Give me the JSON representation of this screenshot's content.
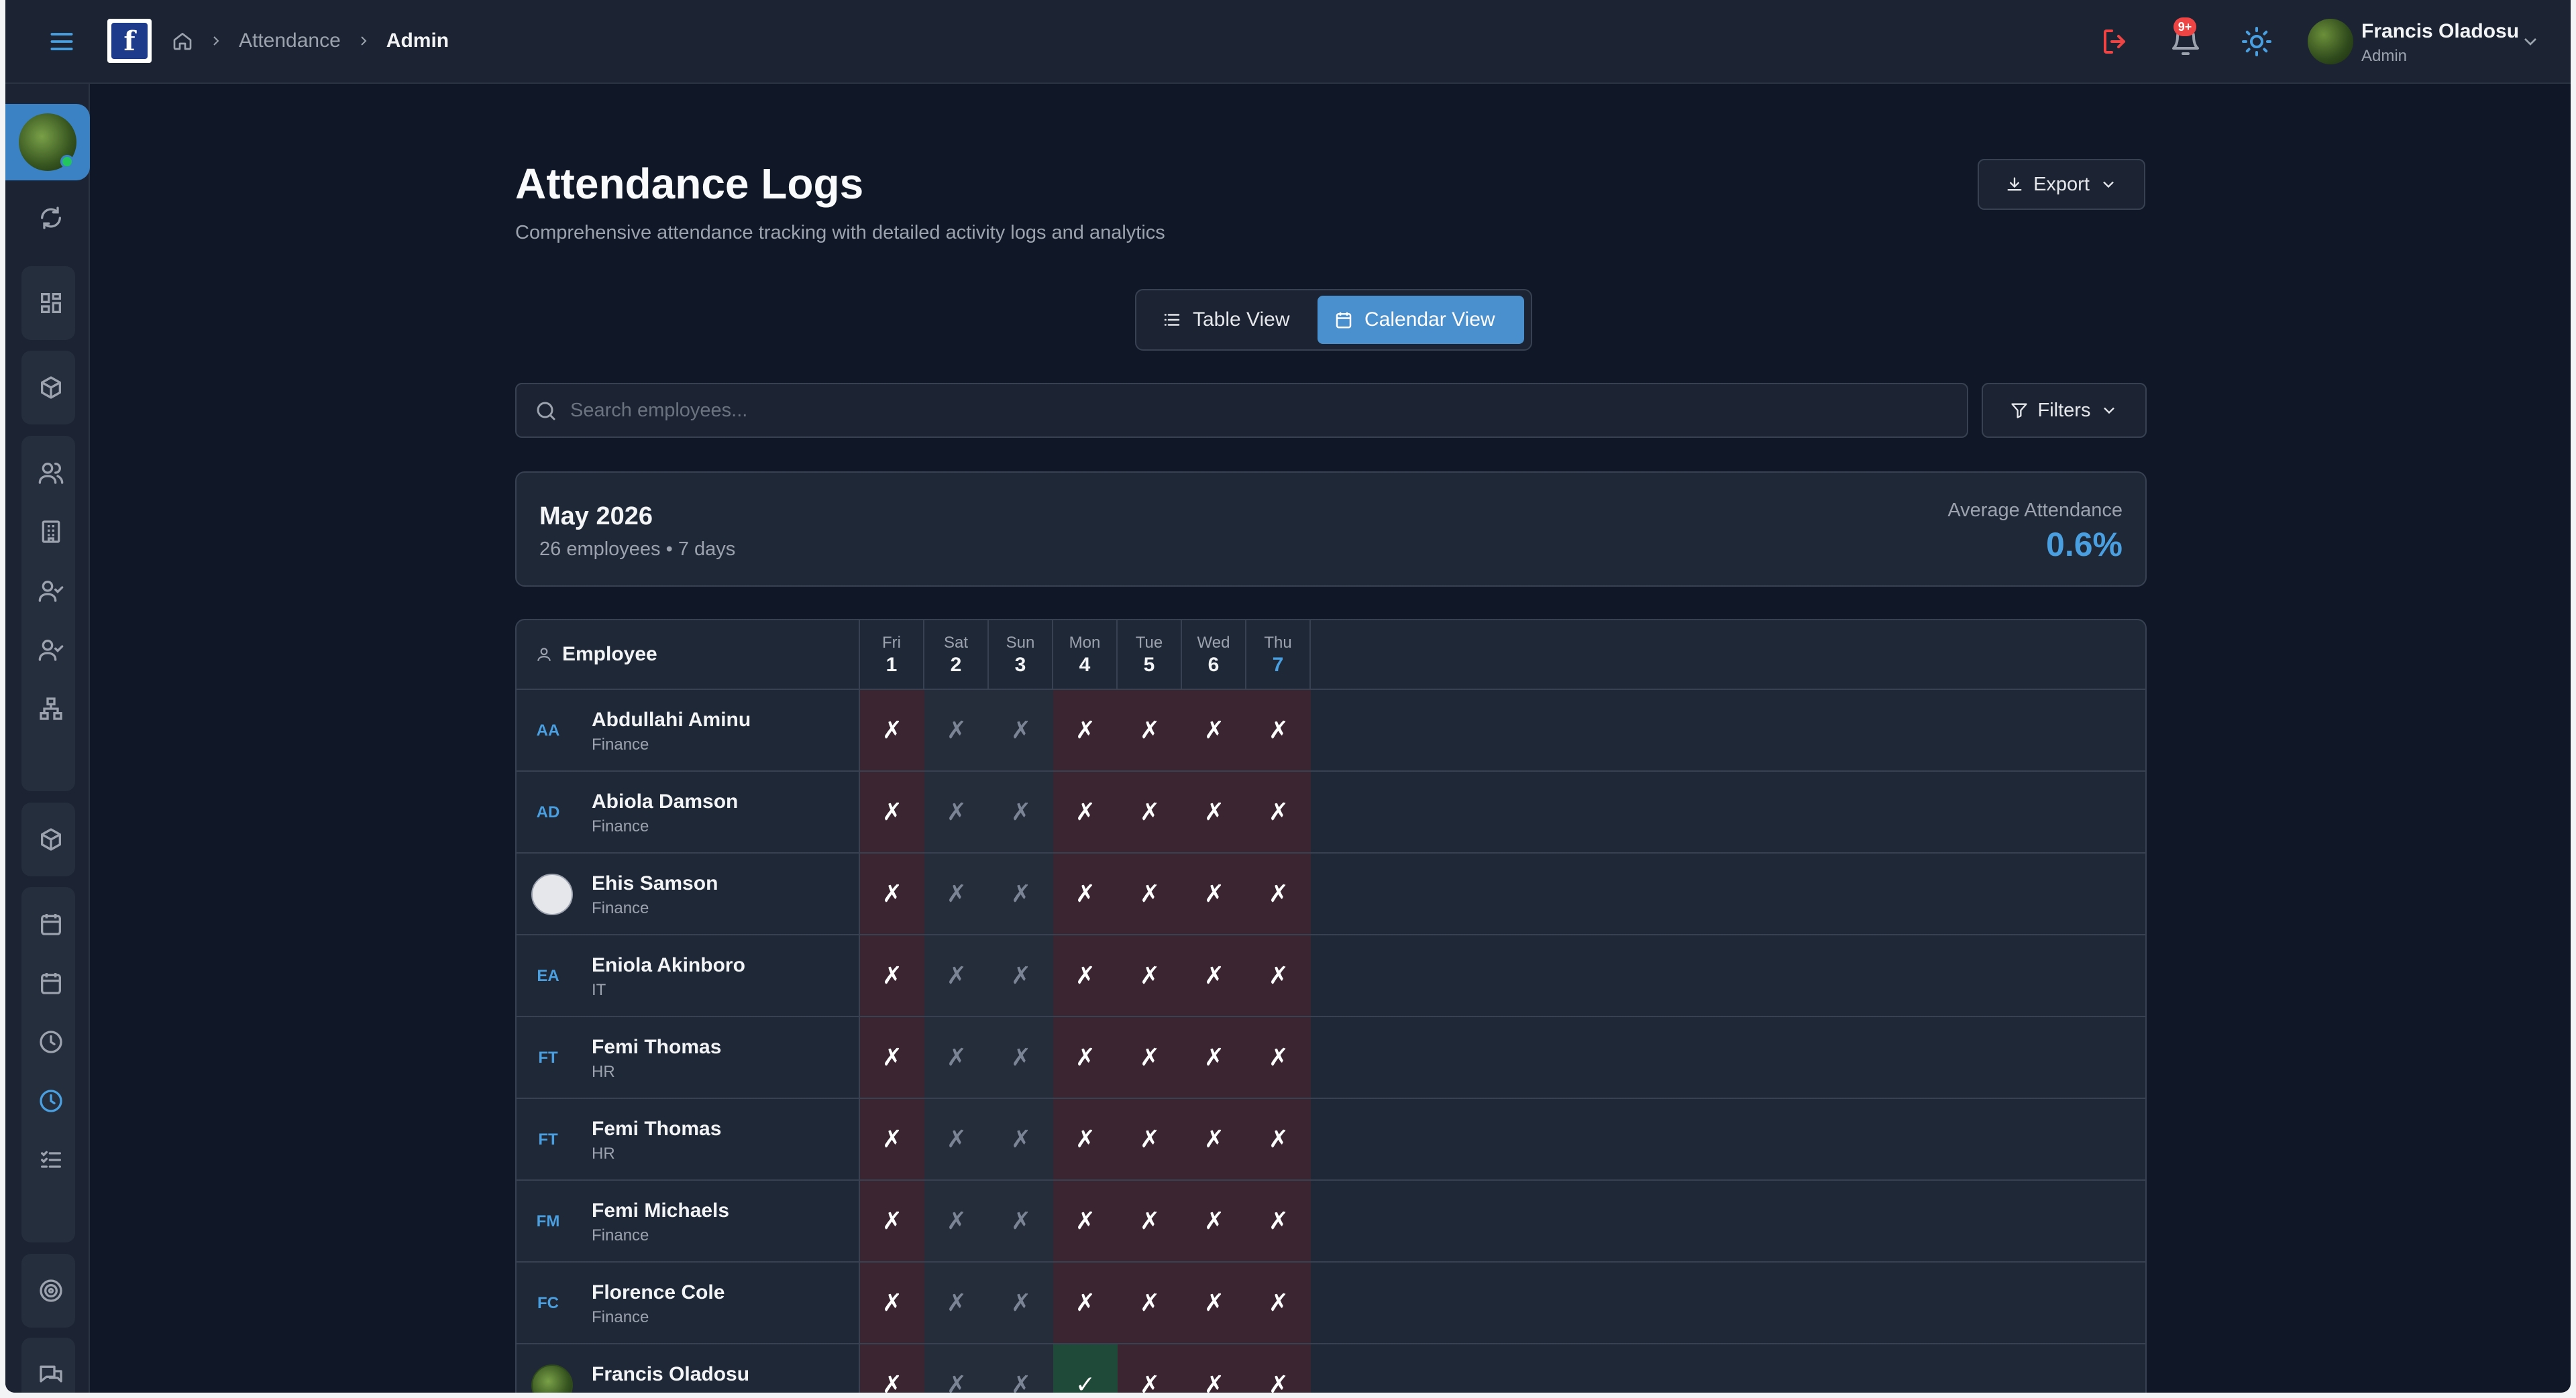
{
  "topbar": {
    "breadcrumb": [
      "Attendance",
      "Admin"
    ],
    "notifications_badge": "9+",
    "user": {
      "name": "Francis Oladosu",
      "role": "Admin"
    }
  },
  "page": {
    "title": "Attendance Logs",
    "subtitle": "Comprehensive attendance tracking with detailed activity logs and analytics",
    "export_label": "Export",
    "view_toggle": {
      "table_label": "Table View",
      "calendar_label": "Calendar View",
      "active": "Calendar View"
    },
    "search_placeholder": "Search employees...",
    "filters_label": "Filters"
  },
  "summary": {
    "month": "May 2026",
    "meta": "26 employees • 7 days",
    "avg_label": "Average Attendance",
    "avg_value": "0.6%"
  },
  "calendar": {
    "employee_header": "Employee",
    "days": [
      {
        "dow": "Fri",
        "num": "1"
      },
      {
        "dow": "Sat",
        "num": "2"
      },
      {
        "dow": "Sun",
        "num": "3"
      },
      {
        "dow": "Mon",
        "num": "4"
      },
      {
        "dow": "Tue",
        "num": "5"
      },
      {
        "dow": "Wed",
        "num": "6"
      },
      {
        "dow": "Thu",
        "num": "7"
      }
    ],
    "employees": [
      {
        "initials": "AA",
        "name": "Abdullahi Aminu",
        "dept": "Finance",
        "status": [
          "absent",
          "weekend",
          "weekend",
          "absent",
          "absent",
          "absent",
          "absent"
        ]
      },
      {
        "initials": "AD",
        "name": "Abiola Damson",
        "dept": "Finance",
        "status": [
          "absent",
          "weekend",
          "weekend",
          "absent",
          "absent",
          "absent",
          "absent"
        ]
      },
      {
        "initials": "",
        "photo": "broken",
        "name": "Ehis Samson",
        "dept": "Finance",
        "status": [
          "absent",
          "weekend",
          "weekend",
          "absent",
          "absent",
          "absent",
          "absent"
        ]
      },
      {
        "initials": "EA",
        "name": "Eniola Akinboro",
        "dept": "IT",
        "status": [
          "absent",
          "weekend",
          "weekend",
          "absent",
          "absent",
          "absent",
          "absent"
        ]
      },
      {
        "initials": "FT",
        "name": "Femi Thomas",
        "dept": "HR",
        "status": [
          "absent",
          "weekend",
          "weekend",
          "absent",
          "absent",
          "absent",
          "absent"
        ]
      },
      {
        "initials": "FT",
        "name": "Femi Thomas",
        "dept": "HR",
        "status": [
          "absent",
          "weekend",
          "weekend",
          "absent",
          "absent",
          "absent",
          "absent"
        ]
      },
      {
        "initials": "FM",
        "name": "Femi Michaels",
        "dept": "Finance",
        "status": [
          "absent",
          "weekend",
          "weekend",
          "absent",
          "absent",
          "absent",
          "absent"
        ]
      },
      {
        "initials": "FC",
        "name": "Florence Cole",
        "dept": "Finance",
        "status": [
          "absent",
          "weekend",
          "weekend",
          "absent",
          "absent",
          "absent",
          "absent"
        ]
      },
      {
        "initials": "",
        "photo": "green",
        "name": "Francis Oladosu",
        "dept": "",
        "status": [
          "absent",
          "weekend",
          "weekend",
          "present",
          "absent",
          "absent",
          "absent"
        ]
      }
    ],
    "symbols": {
      "absent": "✗",
      "weekend": "✗",
      "present": "✓"
    }
  },
  "colors": {
    "accent": "#4a90cf",
    "absent_cell": "#3a2530",
    "present_cell": "#1f4a3a",
    "logout_icon": "#ef4444"
  }
}
